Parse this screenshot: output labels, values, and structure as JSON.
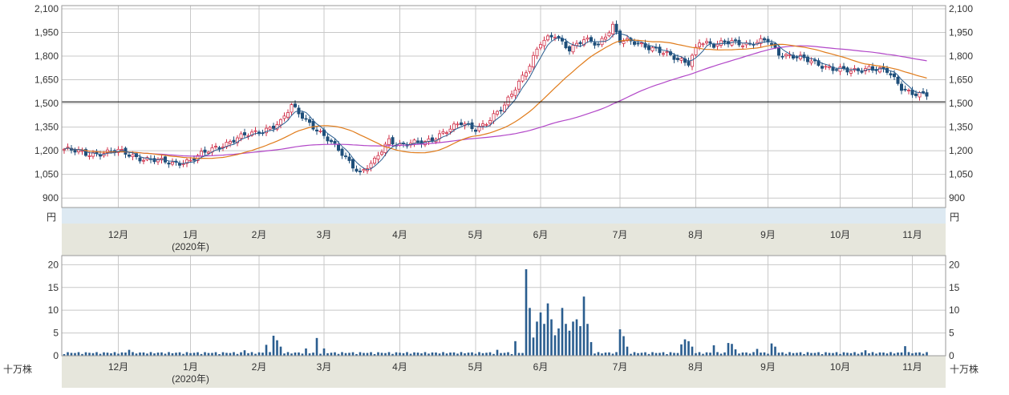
{
  "colors": {
    "up_candle": "#d0314a",
    "down_candle": "#1f4f7a",
    "ma_short": "#2a5d8f",
    "ma_mid": "#e07b1a",
    "ma_long": "#b247c8",
    "volume_bar": "#2a5d8f",
    "grid": "#c8c8c8",
    "frame": "#9a9a9a",
    "axis_band": "#e6e6dc",
    "unit_band": "#dde9f2",
    "hline": "#000000"
  },
  "price_unit": "円",
  "volume_unit": "十万株",
  "year_label": "(2020年)",
  "chart_data": [
    {
      "type": "candlestick",
      "price_axis": {
        "ylim": [
          840,
          2120
        ],
        "ticks": [
          "2,100",
          "1,950",
          "1,800",
          "1,650",
          "1,500",
          "1,350",
          "1,200",
          "1,050",
          "900"
        ],
        "tick_values": [
          2100,
          1950,
          1800,
          1650,
          1500,
          1350,
          1200,
          1050,
          900
        ]
      },
      "months": [
        {
          "label": "12月",
          "x_index": 15
        },
        {
          "label": "1月",
          "x_index": 35
        },
        {
          "label": "2月",
          "x_index": 54
        },
        {
          "label": "3月",
          "x_index": 72
        },
        {
          "label": "4月",
          "x_index": 93
        },
        {
          "label": "5月",
          "x_index": 114
        },
        {
          "label": "6月",
          "x_index": 132
        },
        {
          "label": "7月",
          "x_index": 154
        },
        {
          "label": "8月",
          "x_index": 175
        },
        {
          "label": "9月",
          "x_index": 195
        },
        {
          "label": "10月",
          "x_index": 215
        },
        {
          "label": "11月",
          "x_index": 235
        }
      ],
      "horizontal_line": 1510,
      "close_keypoints": [
        [
          0,
          1210
        ],
        [
          6,
          1180
        ],
        [
          15,
          1195
        ],
        [
          22,
          1150
        ],
        [
          30,
          1120
        ],
        [
          35,
          1140
        ],
        [
          42,
          1220
        ],
        [
          48,
          1280
        ],
        [
          54,
          1320
        ],
        [
          60,
          1380
        ],
        [
          63,
          1480
        ],
        [
          68,
          1380
        ],
        [
          72,
          1290
        ],
        [
          78,
          1160
        ],
        [
          82,
          1060
        ],
        [
          86,
          1130
        ],
        [
          90,
          1270
        ],
        [
          93,
          1240
        ],
        [
          100,
          1250
        ],
        [
          105,
          1320
        ],
        [
          110,
          1370
        ],
        [
          114,
          1340
        ],
        [
          118,
          1400
        ],
        [
          122,
          1480
        ],
        [
          126,
          1640
        ],
        [
          129,
          1750
        ],
        [
          132,
          1880
        ],
        [
          136,
          1930
        ],
        [
          140,
          1850
        ],
        [
          144,
          1900
        ],
        [
          148,
          1870
        ],
        [
          152,
          2000
        ],
        [
          154,
          1900
        ],
        [
          158,
          1880
        ],
        [
          164,
          1850
        ],
        [
          170,
          1770
        ],
        [
          173,
          1760
        ],
        [
          176,
          1900
        ],
        [
          180,
          1860
        ],
        [
          185,
          1900
        ],
        [
          190,
          1870
        ],
        [
          195,
          1900
        ],
        [
          198,
          1820
        ],
        [
          203,
          1790
        ],
        [
          208,
          1760
        ],
        [
          213,
          1720
        ],
        [
          218,
          1700
        ],
        [
          223,
          1730
        ],
        [
          228,
          1700
        ],
        [
          232,
          1600
        ],
        [
          235,
          1570
        ],
        [
          239,
          1550
        ]
      ]
    },
    {
      "type": "bar",
      "volume_axis": {
        "ylim": [
          0,
          22
        ],
        "ticks": [
          "20",
          "15",
          "10",
          "5",
          "0"
        ],
        "tick_values": [
          20,
          15,
          10,
          5,
          0
        ]
      },
      "volume_spikes": [
        [
          18,
          1.3
        ],
        [
          50,
          1.2
        ],
        [
          56,
          2.4
        ],
        [
          58,
          4.4
        ],
        [
          59,
          3.4
        ],
        [
          60,
          2.0
        ],
        [
          67,
          1.6
        ],
        [
          70,
          3.9
        ],
        [
          72,
          1.6
        ],
        [
          120,
          1.3
        ],
        [
          125,
          3.2
        ],
        [
          128,
          19.0
        ],
        [
          129,
          10.5
        ],
        [
          130,
          4.0
        ],
        [
          131,
          7.5
        ],
        [
          132,
          9.5
        ],
        [
          133,
          7.0
        ],
        [
          134,
          11.5
        ],
        [
          135,
          8.0
        ],
        [
          136,
          4.5
        ],
        [
          137,
          6.0
        ],
        [
          138,
          10.5
        ],
        [
          139,
          7.0
        ],
        [
          140,
          5.5
        ],
        [
          141,
          7.5
        ],
        [
          142,
          8.0
        ],
        [
          143,
          6.5
        ],
        [
          144,
          13.0
        ],
        [
          145,
          7.0
        ],
        [
          146,
          3.0
        ],
        [
          154,
          5.8
        ],
        [
          155,
          4.3
        ],
        [
          156,
          2.0
        ],
        [
          171,
          2.5
        ],
        [
          172,
          3.6
        ],
        [
          173,
          3.2
        ],
        [
          174,
          2.0
        ],
        [
          180,
          2.3
        ],
        [
          184,
          2.8
        ],
        [
          185,
          2.6
        ],
        [
          186,
          1.4
        ],
        [
          192,
          1.5
        ],
        [
          196,
          2.7
        ],
        [
          197,
          2.0
        ],
        [
          222,
          1.2
        ],
        [
          233,
          2.1
        ]
      ]
    }
  ]
}
